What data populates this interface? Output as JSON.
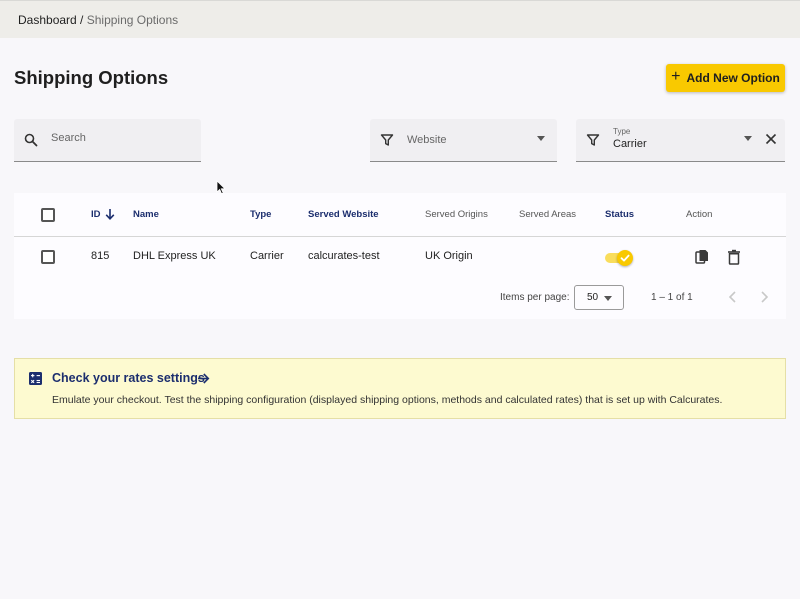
{
  "breadcrumb": {
    "root": "Dashboard",
    "separator": " / ",
    "current": "Shipping Options"
  },
  "page": {
    "title": "Shipping Options"
  },
  "add_button": {
    "icon": "plus-icon",
    "label": "Add New Option"
  },
  "filters": {
    "search": {
      "icon": "search-icon",
      "placeholder": "Search"
    },
    "website": {
      "icon": "filter-icon",
      "placeholder": "Website"
    },
    "type": {
      "icon": "filter-icon",
      "label": "Type",
      "value": "Carrier",
      "clear_icon": "close-icon"
    }
  },
  "table": {
    "columns": {
      "id": "ID",
      "name": "Name",
      "type": "Type",
      "served_website": "Served Website",
      "served_origins": "Served Origins",
      "served_areas": "Served Areas",
      "status": "Status",
      "action": "Action"
    },
    "sort": {
      "column": "ID",
      "direction": "descending",
      "icon": "arrow-down-icon"
    },
    "rows": [
      {
        "id": "815",
        "name": "DHL Express UK",
        "type": "Carrier",
        "served_website": "calcurates-test",
        "served_origins": "UK Origin",
        "served_areas": "",
        "status_enabled": true,
        "actions": [
          "copy-icon",
          "delete-icon"
        ]
      }
    ]
  },
  "paginator": {
    "items_per_page_label": "Items per page:",
    "items_per_page": "50",
    "range": "1 – 1 of 1"
  },
  "rates_card": {
    "icon": "calculator-icon",
    "title": "Check your rates settings",
    "arrow_icon": "arrow-right-icon",
    "description": "Emulate your checkout. Test the shipping configuration (displayed shipping options, methods and calculated rates) that is set up with Calcurates."
  },
  "colors": {
    "accent": "#f9c900",
    "link": "#1c2e6e",
    "card_bg": "#fdfad0"
  }
}
